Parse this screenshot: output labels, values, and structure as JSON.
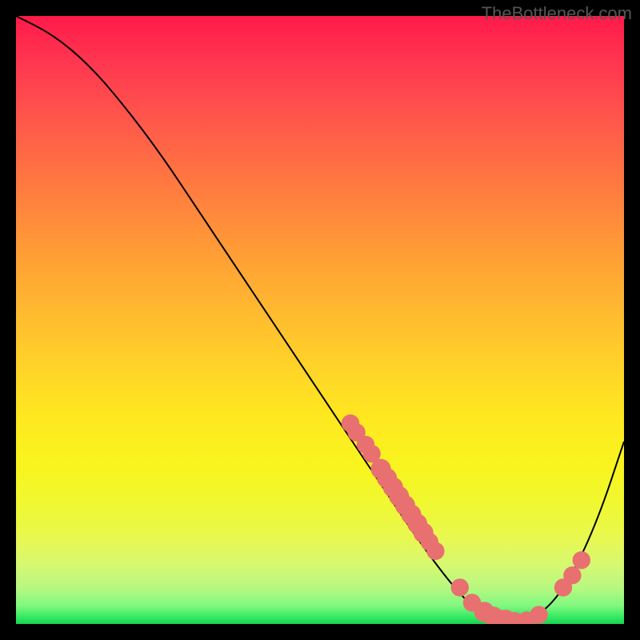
{
  "watermark": "TheBottleneck.com",
  "chart_data": {
    "type": "line",
    "title": "",
    "xlabel": "",
    "ylabel": "",
    "xlim": [
      0,
      100
    ],
    "ylim": [
      0,
      100
    ],
    "curve": [
      {
        "x": 0,
        "y": 100
      },
      {
        "x": 6,
        "y": 97
      },
      {
        "x": 12,
        "y": 92
      },
      {
        "x": 18,
        "y": 85
      },
      {
        "x": 24,
        "y": 77
      },
      {
        "x": 30,
        "y": 68
      },
      {
        "x": 36,
        "y": 59
      },
      {
        "x": 42,
        "y": 50
      },
      {
        "x": 48,
        "y": 41
      },
      {
        "x": 54,
        "y": 32
      },
      {
        "x": 60,
        "y": 23
      },
      {
        "x": 66,
        "y": 14
      },
      {
        "x": 72,
        "y": 6
      },
      {
        "x": 76,
        "y": 2
      },
      {
        "x": 80,
        "y": 0.5
      },
      {
        "x": 84,
        "y": 0.5
      },
      {
        "x": 88,
        "y": 3
      },
      {
        "x": 92,
        "y": 9
      },
      {
        "x": 96,
        "y": 18
      },
      {
        "x": 100,
        "y": 30
      }
    ],
    "markers": [
      {
        "x": 55,
        "y": 33,
        "r": 1.2
      },
      {
        "x": 56,
        "y": 31.5,
        "r": 1.2
      },
      {
        "x": 57.5,
        "y": 29.5,
        "r": 1.2
      },
      {
        "x": 58.5,
        "y": 28,
        "r": 1.2
      },
      {
        "x": 60,
        "y": 25.5,
        "r": 1.4
      },
      {
        "x": 61,
        "y": 24,
        "r": 1.4
      },
      {
        "x": 62,
        "y": 22.5,
        "r": 1.4
      },
      {
        "x": 63,
        "y": 21,
        "r": 1.4
      },
      {
        "x": 64,
        "y": 19.5,
        "r": 1.4
      },
      {
        "x": 65,
        "y": 18,
        "r": 1.4
      },
      {
        "x": 66,
        "y": 16.5,
        "r": 1.4
      },
      {
        "x": 67,
        "y": 15,
        "r": 1.4
      },
      {
        "x": 68,
        "y": 13.5,
        "r": 1.2
      },
      {
        "x": 69,
        "y": 12,
        "r": 1.2
      },
      {
        "x": 73,
        "y": 6,
        "r": 1.2
      },
      {
        "x": 75,
        "y": 3.5,
        "r": 1.2
      },
      {
        "x": 77,
        "y": 2,
        "r": 1.4
      },
      {
        "x": 78.5,
        "y": 1.2,
        "r": 1.4
      },
      {
        "x": 80.5,
        "y": 0.7,
        "r": 1.4
      },
      {
        "x": 82,
        "y": 0.5,
        "r": 1.2
      },
      {
        "x": 84,
        "y": 0.6,
        "r": 1.2
      },
      {
        "x": 86,
        "y": 1.5,
        "r": 1.2
      },
      {
        "x": 90,
        "y": 6,
        "r": 1.2
      },
      {
        "x": 91.5,
        "y": 8,
        "r": 1.2
      },
      {
        "x": 93,
        "y": 10.5,
        "r": 1.2
      }
    ],
    "marker_color": "#e87070",
    "line_color": "#000000"
  }
}
